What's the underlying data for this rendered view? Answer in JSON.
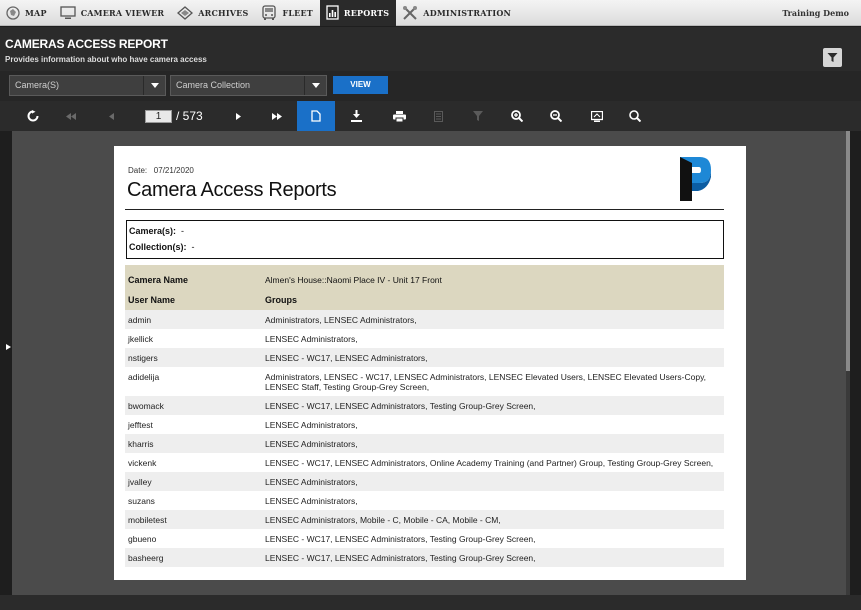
{
  "nav": {
    "items": [
      {
        "label": "MAP",
        "icon": "map-icon"
      },
      {
        "label": "CAMERA VIEWER",
        "icon": "monitor-icon"
      },
      {
        "label": "ARCHIVES",
        "icon": "archives-icon"
      },
      {
        "label": "FLEET",
        "icon": "bus-icon"
      },
      {
        "label": "REPORTS",
        "icon": "report-icon",
        "active": true
      },
      {
        "label": "ADMINISTRATION",
        "icon": "tools-icon"
      }
    ],
    "user": "Training Demo"
  },
  "header": {
    "title": "CAMERAS ACCESS REPORT",
    "subtitle": "Provides information about who have camera access"
  },
  "filters": {
    "camera_select": "Camera(S)",
    "collection_select": "Camera Collection",
    "view_label": "VIEW"
  },
  "toolbar": {
    "current_page": "1",
    "total_pages": "/ 573"
  },
  "report": {
    "date_label": "Date:",
    "date_value": "07/21/2020",
    "title": "Camera Access Reports",
    "camera_label": "Camera(s):",
    "camera_value": "-",
    "collection_label": "Collection(s):",
    "collection_value": "-",
    "camera_name_header": "Camera Name",
    "camera_name_value": "Almen's House::Naomi Place IV - Unit 17 Front",
    "user_header": "User Name",
    "groups_header": "Groups",
    "rows": [
      {
        "user": "admin",
        "groups": "Administrators, LENSEC Administrators,"
      },
      {
        "user": "jkellick",
        "groups": "LENSEC Administrators,"
      },
      {
        "user": "nstigers",
        "groups": "LENSEC - WC17, LENSEC Administrators,"
      },
      {
        "user": "adidelija",
        "groups": "Administrators, LENSEC - WC17, LENSEC Administrators, LENSEC Elevated Users, LENSEC Elevated Users-Copy, LENSEC Staff, Testing Group-Grey Screen,"
      },
      {
        "user": "bwomack",
        "groups": "LENSEC - WC17, LENSEC Administrators, Testing Group-Grey Screen,"
      },
      {
        "user": "jefftest",
        "groups": "LENSEC Administrators,"
      },
      {
        "user": "kharris",
        "groups": "LENSEC Administrators,"
      },
      {
        "user": "vickenk",
        "groups": "LENSEC - WC17, LENSEC Administrators, Online Academy Training (and Partner) Group, Testing Group-Grey Screen,"
      },
      {
        "user": "jvalley",
        "groups": "LENSEC Administrators,"
      },
      {
        "user": "suzans",
        "groups": "LENSEC Administrators,"
      },
      {
        "user": "mobiletest",
        "groups": "LENSEC Administrators, Mobile - C, Mobile - CA, Mobile - CM,"
      },
      {
        "user": "gbueno",
        "groups": "LENSEC - WC17, LENSEC Administrators, Testing Group-Grey Screen,"
      },
      {
        "user": "basheerg",
        "groups": "LENSEC - WC17, LENSEC Administrators, Testing Group-Grey Screen,"
      }
    ]
  },
  "colors": {
    "accent": "#1a70c8",
    "header_bg": "#2b2b2b",
    "table_header_bg": "#dcd7c0",
    "logo_blue": "#1e88d6"
  }
}
